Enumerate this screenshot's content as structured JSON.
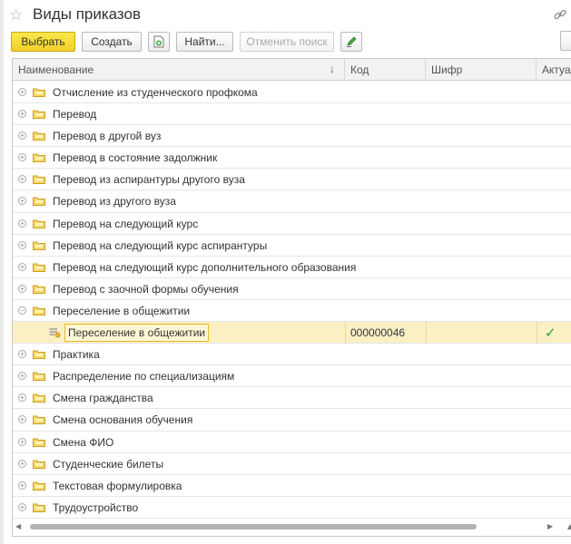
{
  "window": {
    "title": "Виды приказов"
  },
  "toolbar": {
    "select_label": "Выбрать",
    "create_label": "Создать",
    "find_label": "Найти...",
    "cancel_search_label": "Отменить поиск"
  },
  "columns": {
    "name": "Наименование",
    "code": "Код",
    "cipher": "Шифр",
    "actual": "Актуаль"
  },
  "rows": [
    {
      "name": "Отчисление из студенческого профкома"
    },
    {
      "name": "Перевод"
    },
    {
      "name": "Перевод в другой вуз"
    },
    {
      "name": "Перевод в состояние задолжник"
    },
    {
      "name": "Перевод из аспирантуры другого вуза"
    },
    {
      "name": "Перевод из другого вуза"
    },
    {
      "name": "Перевод на следующий курс"
    },
    {
      "name": "Перевод на следующий курс аспирантуры"
    },
    {
      "name": "Перевод на следующий курс дополнительного образования"
    },
    {
      "name": "Перевод с заочной формы обучения"
    },
    {
      "name": "Переселение в общежитии"
    },
    {
      "name": "Переселение в общежитии",
      "code": "000000046",
      "actual": true
    },
    {
      "name": "Практика"
    },
    {
      "name": "Распределение по специализациям"
    },
    {
      "name": "Смена гражданства"
    },
    {
      "name": "Смена основания обучения"
    },
    {
      "name": "Смена ФИО"
    },
    {
      "name": "Студенческие билеты"
    },
    {
      "name": "Текстовая формулировка"
    },
    {
      "name": "Трудоустройство"
    }
  ]
}
